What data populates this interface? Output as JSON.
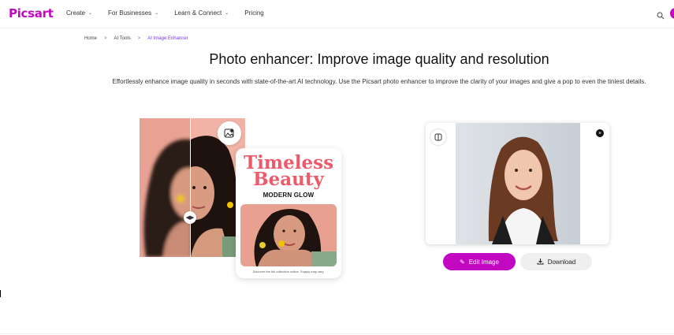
{
  "header": {
    "logo": "Picsart",
    "nav": [
      {
        "label": "Create",
        "has_chevron": true
      },
      {
        "label": "For Businesses",
        "has_chevron": true
      },
      {
        "label": "Learn & Connect",
        "has_chevron": true
      },
      {
        "label": "Pricing",
        "has_chevron": false
      }
    ],
    "icons": {
      "search": "search-icon"
    }
  },
  "breadcrumb": {
    "items": [
      "Home",
      "AI Tools",
      "AI Image Enhancer"
    ],
    "separator": ">"
  },
  "hero": {
    "title": "Photo enhancer: Improve image quality and resolution",
    "subtitle": "Effortlessly enhance image quality in seconds with state-of-the-art AI technology. Use the Picsart photo enhancer to improve the clarity of your images and give a pop to even the tiniest details."
  },
  "showcase": {
    "card_title_line1": "Timeless",
    "card_title_line2": "Beauty",
    "card_subtitle": "MODERN GLOW",
    "card_footer": "Discover the full collection online. Supply may vary."
  },
  "actions": {
    "edit_label": "Edit Image",
    "download_label": "Download"
  },
  "colors": {
    "brand": "#c209c1",
    "accent_purple": "#7b2ff7",
    "card_title": "#ef5a6a"
  }
}
